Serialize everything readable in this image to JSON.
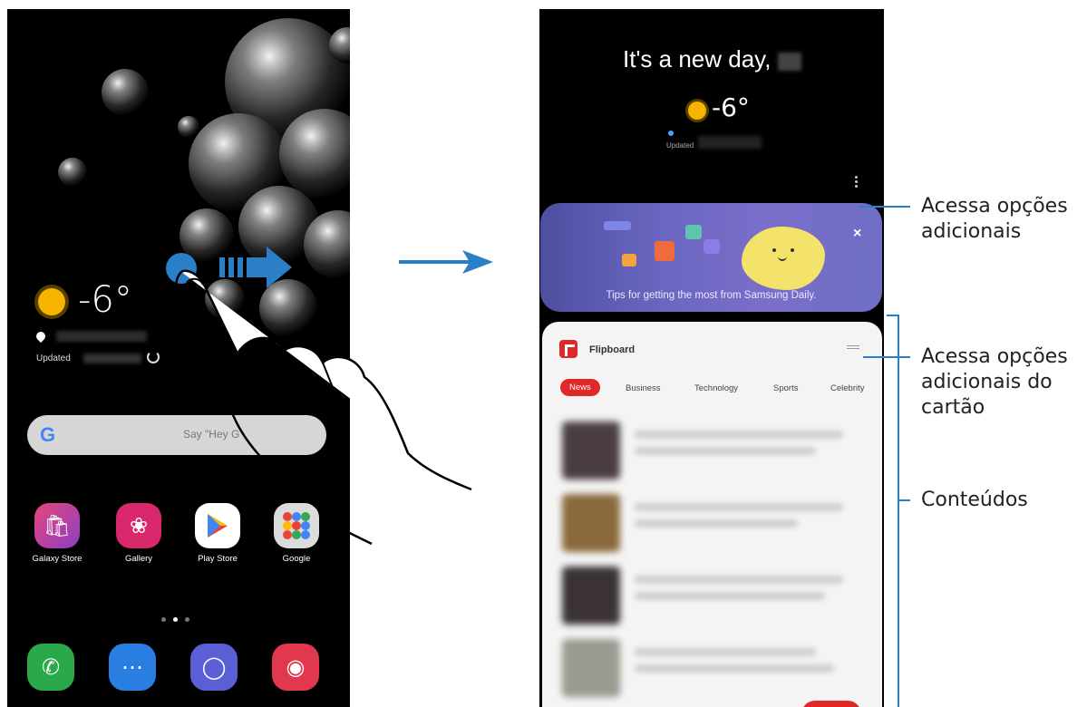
{
  "home_screen": {
    "weather": {
      "temperature": "-6°",
      "updated_label": "Updated"
    },
    "search": {
      "placeholder": "Say \"Hey G"
    },
    "apps": [
      {
        "label": "Galaxy Store",
        "icon": "bag-icon",
        "color": "#c2357f"
      },
      {
        "label": "Gallery",
        "icon": "flower-icon",
        "color": "#d8286b"
      },
      {
        "label": "Play Store",
        "icon": "play-icon",
        "color": "#ffffff"
      },
      {
        "label": "Google",
        "icon": "google-folder-icon",
        "color": "#e8e8e8"
      }
    ],
    "dock": [
      {
        "icon": "phone-icon",
        "color": "#2aa84a"
      },
      {
        "icon": "messages-icon",
        "color": "#2a7de1"
      },
      {
        "icon": "internet-icon",
        "color": "#5a5fd6"
      },
      {
        "icon": "camera-icon",
        "color": "#e2384d"
      }
    ]
  },
  "samsung_daily": {
    "greeting": "It's a new day,",
    "temperature": "-6°",
    "updated_label": "Updated",
    "tips_text": "Tips for getting the most from Samsung Daily.",
    "close_glyph": "×",
    "flipboard": {
      "title": "Flipboard",
      "tabs": [
        "News",
        "Business",
        "Technology",
        "Sports",
        "Celebrity"
      ]
    }
  },
  "annotations": {
    "more_options": [
      "Acessa opções",
      "adicionais"
    ],
    "card_options": [
      "Acessa opções",
      "adicionais do",
      "cartão"
    ],
    "contents": "Conteúdos"
  },
  "colors": {
    "accent_blue": "#2b7fc7",
    "flipboard_red": "#e12828",
    "tips_purple": "#6a66c0"
  }
}
